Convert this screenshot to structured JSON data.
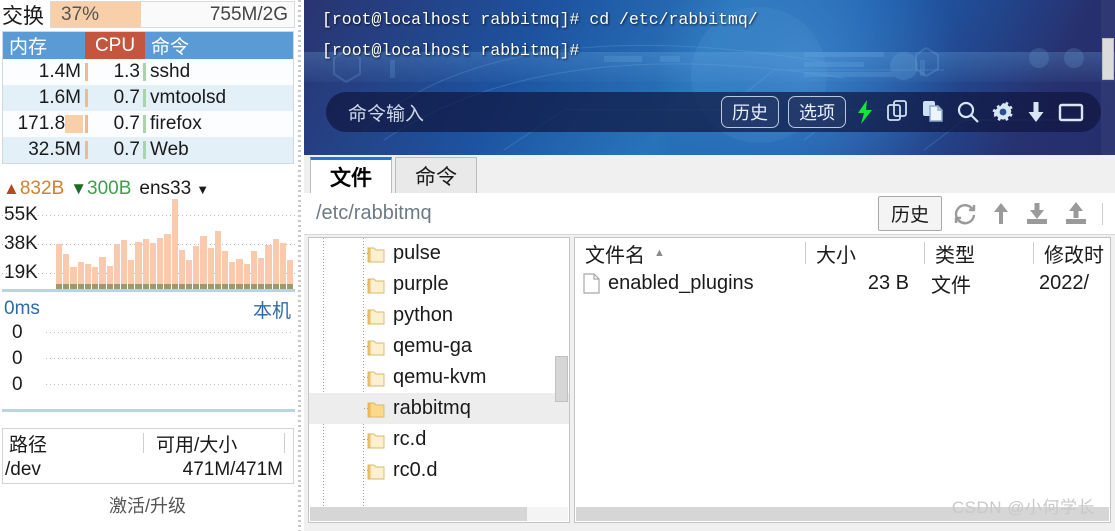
{
  "monitor": {
    "swap": {
      "label": "交换",
      "percent_text": "37%",
      "percent_value": 37,
      "total_text": "755M/2G",
      "fill_color": "#f8cfa9"
    },
    "process_table": {
      "headers": {
        "mem": "内存",
        "cpu": "CPU",
        "cmd": "命令"
      },
      "header_color": "#5b9bd5",
      "cpu_header_color": "#c4553f",
      "rows": [
        {
          "mem": "1.4M",
          "cpu": "1.3",
          "cmd": "sshd",
          "bar": false
        },
        {
          "mem": "1.6M",
          "cpu": "0.7",
          "cmd": "vmtoolsd",
          "bar": false
        },
        {
          "mem": "171.8...",
          "cpu": "0.7",
          "cmd": "firefox",
          "bar": true
        },
        {
          "mem": "32.5M",
          "cpu": "0.7",
          "cmd": "Web",
          "bar": false
        }
      ]
    },
    "network": {
      "up_arrow": "arrow-up-icon",
      "up_text": "832B",
      "down_arrow": "arrow-down-icon",
      "down_text": "300B",
      "interface": "ens33",
      "caret": "chevron-down-icon",
      "y_labels": [
        "55K",
        "38K",
        "19K"
      ]
    },
    "ping": {
      "latency": "0ms",
      "host": "本机",
      "y_labels": [
        "0",
        "0",
        "0"
      ]
    },
    "disk": {
      "headers": {
        "path": "路径",
        "size": "可用/大小"
      },
      "rows": [
        {
          "path": "/dev",
          "size": "471M/471M"
        }
      ]
    },
    "activate_label": "激活/升级"
  },
  "terminal": {
    "lines": [
      "[root@localhost rabbitmq]# cd /etc/rabbitmq/",
      "[root@localhost rabbitmq]#"
    ],
    "input_placeholder": "命令输入",
    "buttons": {
      "history": "历史",
      "options": "选项"
    },
    "icons": [
      "lightning-icon",
      "copy-icon",
      "paste-icon",
      "search-icon",
      "gear-icon",
      "download-icon",
      "window-icon"
    ]
  },
  "filebrowser": {
    "tabs": [
      {
        "label": "文件",
        "active": true
      },
      {
        "label": "命令",
        "active": false
      }
    ],
    "path": "/etc/rabbitmq",
    "history_button": "历史",
    "toolbar_icons": [
      "refresh-icon",
      "parent-dir-icon",
      "download-icon",
      "upload-icon"
    ],
    "tree": [
      {
        "name": "pulse",
        "selected": false
      },
      {
        "name": "purple",
        "selected": false
      },
      {
        "name": "python",
        "selected": false
      },
      {
        "name": "qemu-ga",
        "selected": false
      },
      {
        "name": "qemu-kvm",
        "selected": false
      },
      {
        "name": "rabbitmq",
        "selected": true
      },
      {
        "name": "rc.d",
        "selected": false
      },
      {
        "name": "rc0.d",
        "selected": false
      }
    ],
    "list": {
      "headers": {
        "name": "文件名",
        "size": "大小",
        "type": "类型",
        "date": "修改时"
      },
      "sort_indicator": "sort-asc-icon",
      "rows": [
        {
          "name": "enabled_plugins",
          "size": "23 B",
          "type": "文件",
          "date": "2022/"
        }
      ]
    }
  },
  "watermark": "CSDN @小何学长"
}
